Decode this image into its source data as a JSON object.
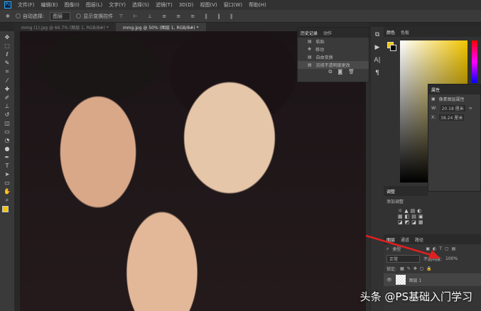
{
  "menu": {
    "items": [
      "文件(F)",
      "编辑(E)",
      "图像(I)",
      "图层(L)",
      "文字(Y)",
      "选择(S)",
      "滤镜(T)",
      "3D(D)",
      "视图(V)",
      "窗口(W)",
      "帮助(H)"
    ]
  },
  "options": {
    "auto_select": "自动选择:",
    "target": "图层",
    "show_transform": "显示变换控件"
  },
  "tabs": [
    {
      "label": "mmg (1).jpg @ 66.7% (图层 1, RGB/8#) *"
    },
    {
      "label": "mmg.jpg @ 50% (图层 1, RGB/8#) *"
    }
  ],
  "history": {
    "tabs": [
      "历史记录",
      "动作"
    ],
    "items": [
      "粘贴",
      "移动",
      "自由变换",
      "另择不透明度更改"
    ]
  },
  "color": {
    "tabs": [
      "颜色",
      "色板"
    ],
    "foreground": "#f2c500",
    "background": "#000000"
  },
  "properties": {
    "title": "属性",
    "subtitle": "像素图层属性",
    "w_label": "W:",
    "w_value": "20.18 厘米",
    "x_label": "X:",
    "x_value": "38.24 厘米"
  },
  "adjustments": {
    "title": "调整",
    "subtitle": "添加调整"
  },
  "layers": {
    "tabs": [
      "图层",
      "通道",
      "路径"
    ],
    "filter": "类型",
    "blend": "正常",
    "opacity_label": "不透明度:",
    "opacity": "100%",
    "lock_label": "锁定:",
    "layer_name": "图层 1"
  },
  "watermark": "头条 @PS基础入门学习"
}
